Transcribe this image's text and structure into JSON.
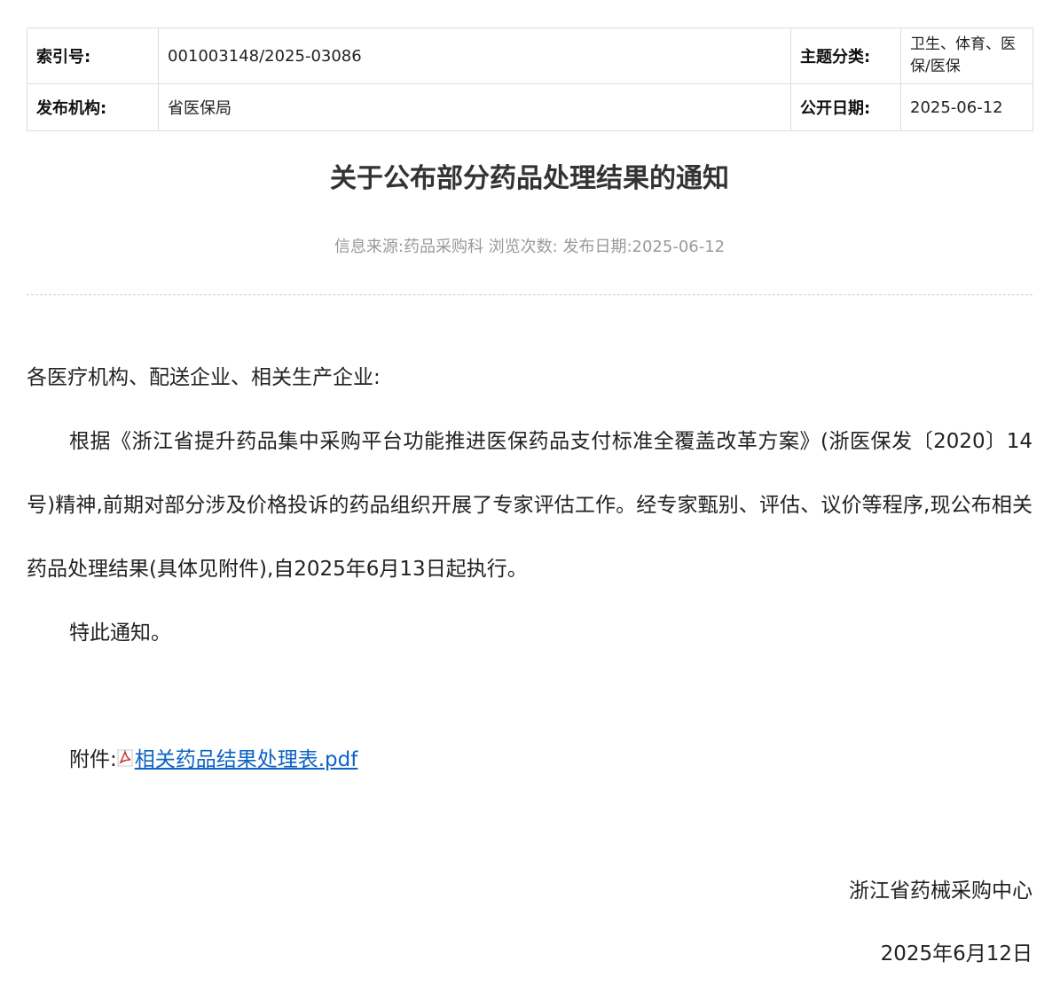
{
  "meta": {
    "index_label": "索引号:",
    "index_value": "001003148/2025-03086",
    "topic_label": "主题分类:",
    "topic_value": "卫生、体育、医保/医保",
    "publisher_label": "发布机构:",
    "publisher_value": "省医保局",
    "open_date_label": "公开日期:",
    "open_date_value": "2025-06-12"
  },
  "article": {
    "title": "关于公布部分药品处理结果的通知",
    "source_line": "信息来源:药品采购科 浏览次数: 发布日期:2025-06-12"
  },
  "content": {
    "salutation": "各医疗机构、配送企业、相关生产企业:",
    "body": "根据《浙江省提升药品集中采购平台功能推进医保药品支付标准全覆盖改革方案》(浙医保发〔2020〕14号)精神,前期对部分涉及价格投诉的药品组织开展了专家评估工作。经专家甄别、评估、议价等程序,现公布相关药品处理结果(具体见附件),自2025年6月13日起执行。",
    "closing": "特此通知。",
    "attachment_label": "附件:",
    "attachment_icon": "pdf-icon",
    "attachment_link": "相关药品结果处理表.pdf"
  },
  "signature": {
    "org": "浙江省药械采购中心",
    "date": "2025年6月12日"
  }
}
